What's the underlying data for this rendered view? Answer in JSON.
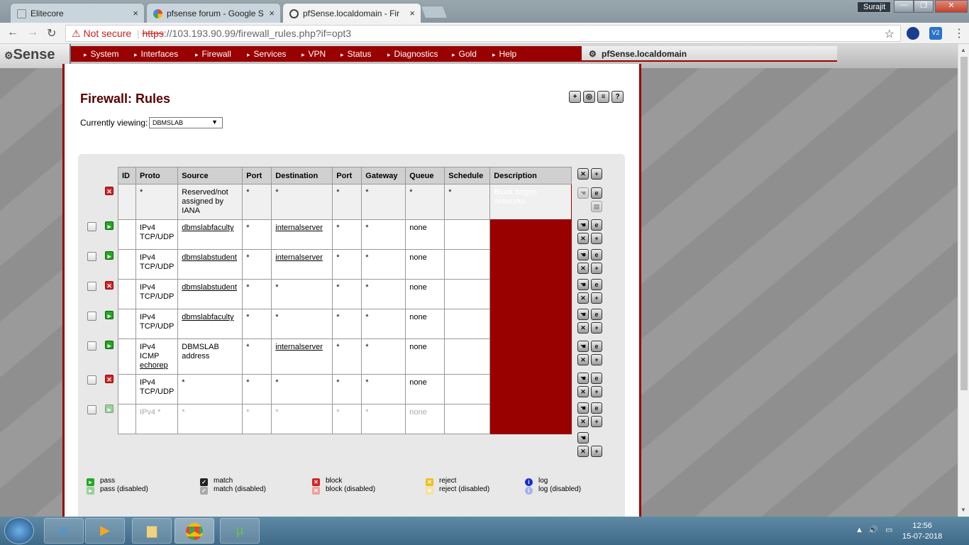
{
  "browser": {
    "tabs": [
      {
        "title": "Elitecore",
        "close": "×"
      },
      {
        "title": "pfsense forum - Google S",
        "close": "×"
      },
      {
        "title": "pfSense.localdomain - Fir",
        "close": "×"
      }
    ],
    "window_user": "Surajit",
    "window_controls": {
      "minimize": "—",
      "maximize": "❐",
      "close": "✕"
    },
    "address": {
      "security_label": "Not secure",
      "scheme": "https",
      "url_rest": "://103.193.90.99/firewall_rules.php?if=opt3"
    },
    "extensions": [
      "V2"
    ]
  },
  "pfsense": {
    "logo": "Sense",
    "menu": [
      "System",
      "Interfaces",
      "Firewall",
      "Services",
      "VPN",
      "Status",
      "Diagnostics",
      "Gold",
      "Help"
    ],
    "hostname": "pfSense.localdomain",
    "page_title": "Firewall: Rules",
    "viewing_label": "Currently viewing:",
    "viewing_value": "DBMSLAB",
    "columns": [
      "ID",
      "Proto",
      "Source",
      "Port",
      "Destination",
      "Port",
      "Gateway",
      "Queue",
      "Schedule",
      "Description"
    ],
    "rules": [
      {
        "action": "block",
        "id": "",
        "proto": "*",
        "source": "Reserved/not assigned by IANA",
        "sport": "*",
        "dest": "*",
        "dport": "*",
        "gateway": "*",
        "queue": "*",
        "schedule": "*",
        "description": "Block bogon networks"
      },
      {
        "action": "pass",
        "id": "",
        "proto": "IPv4 TCP/UDP",
        "source": "dbmslabfaculty",
        "sport": "*",
        "dest": "internalserver",
        "dport": "*",
        "gateway": "*",
        "queue": "none",
        "schedule": "",
        "description": ""
      },
      {
        "action": "pass",
        "id": "",
        "proto": "IPv4 TCP/UDP",
        "source": "dbmslabstudent",
        "sport": "*",
        "dest": "internalserver",
        "dport": "*",
        "gateway": "*",
        "queue": "none",
        "schedule": "",
        "description": ""
      },
      {
        "action": "block",
        "id": "",
        "proto": "IPv4 TCP/UDP",
        "source": "dbmslabstudent",
        "sport": "*",
        "dest": "*",
        "dport": "*",
        "gateway": "*",
        "queue": "none",
        "schedule": "",
        "description": ""
      },
      {
        "action": "pass",
        "id": "",
        "proto": "IPv4 TCP/UDP",
        "source": "dbmslabfaculty",
        "sport": "*",
        "dest": "*",
        "dport": "*",
        "gateway": "*",
        "queue": "none",
        "schedule": "",
        "description": ""
      },
      {
        "action": "pass",
        "id": "",
        "proto_line1": "IPv4",
        "proto_line2": "ICMP",
        "proto_link": "echorep",
        "source": "DBMSLAB address",
        "sport": "*",
        "dest": "internalserver",
        "dport": "*",
        "gateway": "*",
        "queue": "none",
        "schedule": "",
        "description": ""
      },
      {
        "action": "block",
        "id": "",
        "proto": "IPv4 TCP/UDP",
        "source": "*",
        "sport": "*",
        "dest": "*",
        "dport": "*",
        "gateway": "*",
        "queue": "none",
        "schedule": "",
        "description": ""
      },
      {
        "action": "pass-disabled",
        "id": "",
        "proto": "IPv4 *",
        "source": "*",
        "sport": "*",
        "dest": "*",
        "dport": "*",
        "gateway": "*",
        "queue": "none",
        "schedule": "",
        "description": ""
      }
    ],
    "legend": [
      {
        "label": "pass",
        "color": "#22a822"
      },
      {
        "label": "pass (disabled)",
        "color": "#9ad09a"
      },
      {
        "label": "match",
        "color": "#222222"
      },
      {
        "label": "match (disabled)",
        "color": "#aaaaaa"
      },
      {
        "label": "block",
        "color": "#d32222"
      },
      {
        "label": "block (disabled)",
        "color": "#f0a0a0"
      },
      {
        "label": "reject",
        "color": "#f0c020"
      },
      {
        "label": "reject (disabled)",
        "color": "#f5e2a0"
      },
      {
        "label": "log",
        "color": "#1a2fd0"
      },
      {
        "label": "log (disabled)",
        "color": "#a8b0f0"
      }
    ],
    "accent_color": "#990000"
  },
  "taskbar": {
    "time": "12:56",
    "date": "15-07-2018"
  }
}
